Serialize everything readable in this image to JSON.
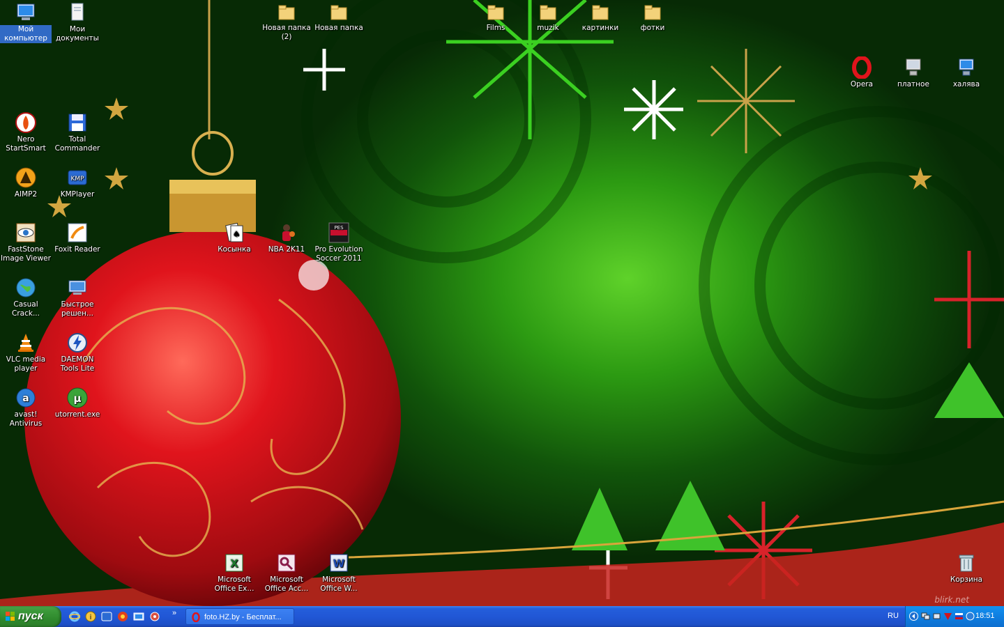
{
  "desktop": {
    "watermark": "blirk.net",
    "icons": {
      "my_computer": "Мой компьютер",
      "my_documents": "Мои документы",
      "new_folder_2": "Новая папка (2)",
      "new_folder": "Новая папка",
      "films": "Films",
      "muzik": "muzik",
      "kartinki": "картинки",
      "fotki": "фотки",
      "opera": "Opera",
      "platnoe": "платное",
      "khalyava": "халява",
      "nero": "Nero StartSmart",
      "total_commander": "Total Commander",
      "aimp2": "AIMP2",
      "kmplayer": "KMPlayer",
      "faststone": "FastStone Image Viewer",
      "foxit": "Foxit Reader",
      "kosynka": "Косынка",
      "nba": "NBA 2K11",
      "pes": "Pro Evolution Soccer 2011",
      "casual": "Casual Crack...",
      "bystroe": "Быстрое решен...",
      "vlc": "VLC media player",
      "daemon": "DAEMON Tools Lite",
      "avast": "avast! Antivirus",
      "utorrent": "utorrent.exe",
      "excel": "Microsoft Office Ex...",
      "access": "Microsoft Office Acc...",
      "word": "Microsoft Office W...",
      "recycle": "Корзина"
    }
  },
  "taskbar": {
    "start_label": "пуск",
    "task_label": "foto.HZ.by - Бесплат...",
    "language": "RU",
    "clock": "18:51",
    "quicklaunch": [
      "ie-icon",
      "info-icon",
      "kmplayer-icon",
      "browser-icon",
      "show-desktop-icon",
      "settings-icon"
    ],
    "colors": {
      "taskbar": "#245edb",
      "start": "#3c9a3a",
      "tray": "#0f7ee0"
    }
  }
}
